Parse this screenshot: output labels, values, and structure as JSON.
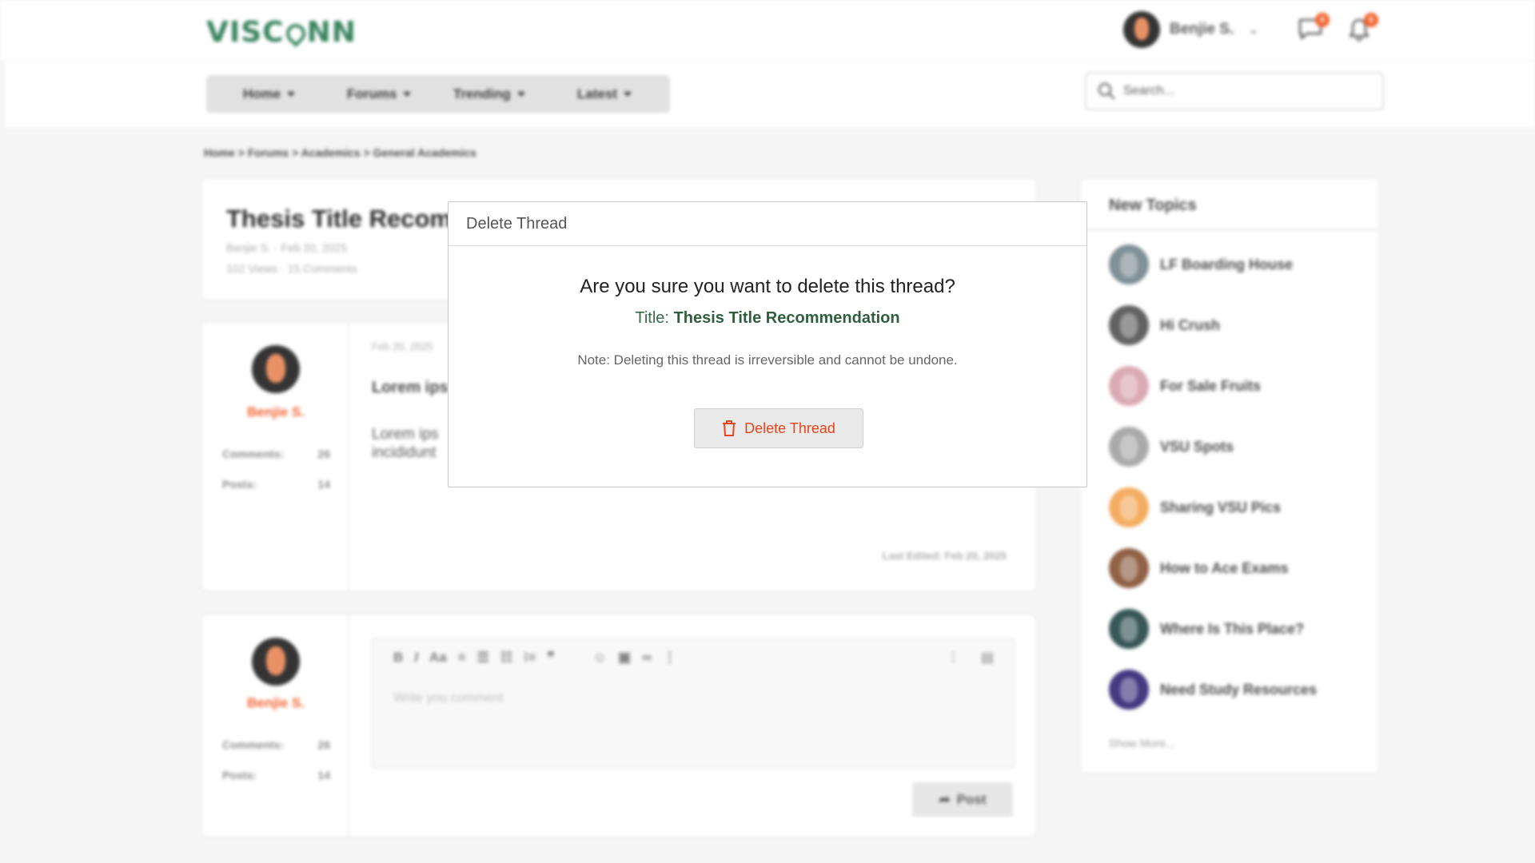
{
  "header": {
    "logo_left": "VISC",
    "logo_right": "NN",
    "user_name": "Benjie S.",
    "messages_badge": "0",
    "notifications_badge": "0"
  },
  "nav": {
    "items": [
      {
        "label": "Home"
      },
      {
        "label": "Forums"
      },
      {
        "label": "Trending"
      },
      {
        "label": "Latest"
      }
    ],
    "search_placeholder": "Search..."
  },
  "breadcrumb": "Home > Forums > Academics > General Academics",
  "thread": {
    "title": "Thesis Title Recom",
    "author_date": "Benjie S. · Feb 20, 2025",
    "stats": "102 Views · 15 Comments"
  },
  "post": {
    "author": "Benjie S.",
    "comments_label": "Comments:",
    "comments_value": "26",
    "posts_label": "Posts:",
    "posts_value": "14",
    "date": "Feb 20, 2025",
    "heading": "Lorem ips",
    "body_line1": "Lorem ips",
    "body_line2": "incididunt",
    "last_edited": "Last Edited: Feb 20, 2025"
  },
  "reply": {
    "author": "Benjie S.",
    "comments_label": "Comments:",
    "comments_value": "26",
    "posts_label": "Posts:",
    "posts_value": "14",
    "placeholder": "Write you comment",
    "post_label": "Post"
  },
  "sidebar": {
    "title": "New Topics",
    "topics": [
      {
        "label": "LF Boarding House",
        "color": "#7a8a93"
      },
      {
        "label": "Hi Crush",
        "color": "#5b5b5b"
      },
      {
        "label": "For Sale Fruits",
        "color": "#d9a6b0"
      },
      {
        "label": "VSU Spots",
        "color": "#a6a6a6"
      },
      {
        "label": "Sharing VSU Pics",
        "color": "#f3a95a"
      },
      {
        "label": "How to Ace Exams",
        "color": "#8b5a3c"
      },
      {
        "label": "Where Is This Place?",
        "color": "#2f4f4f"
      },
      {
        "label": "Need Study Resources",
        "color": "#3b2f7a"
      }
    ],
    "show_more": "Show More..."
  },
  "modal": {
    "header": "Delete Thread",
    "question": "Are you sure you want to delete this thread?",
    "title_label": "Title:",
    "title_value": "Thesis Title Recommendation",
    "note": "Note: Deleting this thread is irreversible and cannot be undone.",
    "delete_label": "Delete Thread"
  },
  "colors": {
    "brand": "#2e7d57",
    "accent": "#f15a24",
    "danger": "#e8451d"
  }
}
